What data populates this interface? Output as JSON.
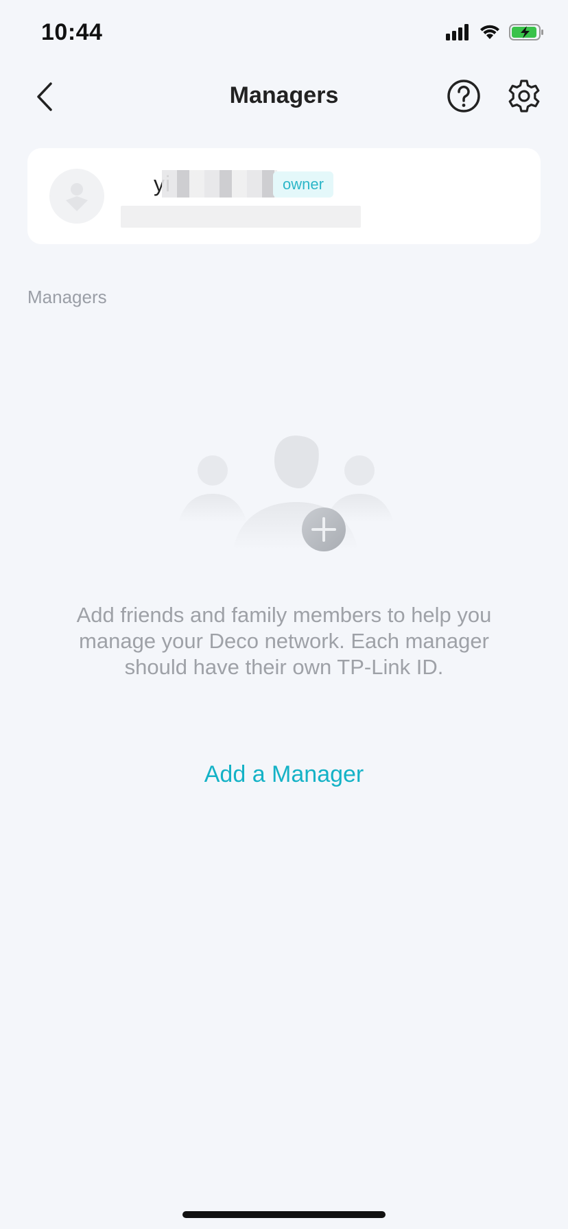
{
  "status_bar": {
    "time": "10:44"
  },
  "header": {
    "title": "Managers",
    "back_icon": "chevron-left-icon",
    "help_icon": "help-circle-icon",
    "settings_icon": "gear-icon"
  },
  "owner": {
    "name_start": "yi",
    "name_end": "n",
    "badge": "owner"
  },
  "managers_section": {
    "label": "Managers",
    "empty_message": "Add friends and family members to help you manage your Deco network. Each manager should have their own TP-Link ID.",
    "add_button": "Add a Manager"
  },
  "colors": {
    "accent": "#14b2c6",
    "badge_bg": "#e4f8fa",
    "background": "#f4f6fa"
  }
}
